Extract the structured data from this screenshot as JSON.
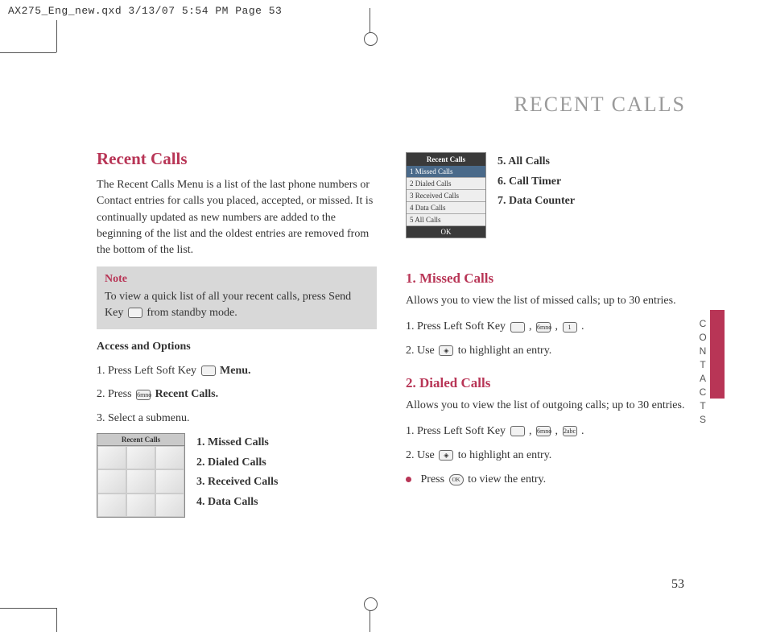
{
  "print_header": "AX275_Eng_new.qxd  3/13/07  5:54 PM  Page 53",
  "page_header": "RECENT CALLS",
  "sidebar_label": "CONTACTS",
  "page_number": "53",
  "left": {
    "h1": "Recent Calls",
    "intro": "The Recent Calls Menu is a list of the last phone numbers or Contact entries for calls you placed, accepted, or missed. It is continually updated as new numbers are added to the beginning of the list and the oldest entries are removed from the bottom of the list.",
    "note_title": "Note",
    "note_text_1": "To view a quick list of all your recent calls, press Send Key ",
    "note_text_2": " from standby mode.",
    "access_title": "Access and Options",
    "step1_a": "1. Press Left Soft Key ",
    "step1_b": " Menu.",
    "step2_a": "2. Press ",
    "step2_b": " Recent Calls.",
    "step3": "3. Select a submenu.",
    "grid_header": "Recent Calls",
    "sublist": {
      "i1": "1. Missed Calls",
      "i2": "2. Dialed Calls",
      "i3": "3. Received Calls",
      "i4": "4. Data Calls"
    }
  },
  "right": {
    "list_header": "Recent Calls",
    "list_items": {
      "i1": "1 Missed Calls",
      "i2": "2 Dialed Calls",
      "i3": "3 Received Calls",
      "i4": "4 Data Calls",
      "i5": "5 All Calls"
    },
    "list_footer": "OK",
    "top_items": {
      "i5": "5. All Calls",
      "i6": "6. Call Timer",
      "i7": "7. Data Counter"
    },
    "sec1_h": "1. Missed Calls",
    "sec1_p": "Allows you to view the list of missed calls; up to 30 entries.",
    "sec1_s1a": "1. Press Left Soft Key ",
    "sec1_s1b": " , ",
    "sec1_s1c": " , ",
    "sec1_s1d": " .",
    "sec1_s2a": "2. Use ",
    "sec1_s2b": " to highlight an entry.",
    "sec2_h": "2. Dialed Calls",
    "sec2_p": "Allows you to view the list of outgoing calls; up to 30 entries.",
    "sec2_s1a": "1. Press Left Soft Key ",
    "sec2_s1b": " , ",
    "sec2_s1c": " , ",
    "sec2_s1d": " .",
    "sec2_s2a": "2.  Use ",
    "sec2_s2b": " to highlight an entry.",
    "sec2_b_a": "Press ",
    "sec2_b_b": " to view the entry.",
    "key_6": "6mno",
    "key_1": "1",
    "key_2": "2abc",
    "key_ok": "OK"
  }
}
